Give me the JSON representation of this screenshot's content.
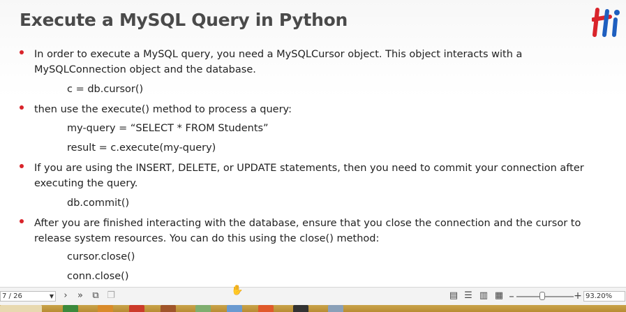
{
  "slide": {
    "title": "Execute a MySQL Query in Python",
    "accent_color": "#d9242b",
    "logo_icon": "hi-logo",
    "bullets": [
      {
        "text": "In order to execute a MySQL query, you need a MySQLCursor object. This object interacts with a MySQLConnection object and the database.",
        "code": [
          "c = db.cursor()"
        ]
      },
      {
        "text": "then use the execute() method to process a query:",
        "code": [
          "my-query = “SELECT * FROM Students”",
          "result = c.execute(my-query)"
        ]
      },
      {
        "text": "If you are using the INSERT, DELETE, or UPDATE statements, then you need to commit your connection after executing the query.",
        "code": [
          "db.commit()"
        ]
      },
      {
        "text": "After you are finished interacting with the database, ensure that you close the connection and the cursor to release system resources. You can do this using the close() method:",
        "code": [
          "cursor.close()",
          "conn.close()"
        ]
      }
    ]
  },
  "statusbar": {
    "page_indicator": "7 / 26",
    "zoom_level": "93.20%",
    "zoom_fraction": 0.45,
    "icons": [
      "next-page-icon",
      "last-page-icon",
      "page-view-icon",
      "copy-icon",
      "single-page-icon",
      "continuous-icon",
      "facing-icon",
      "thumbnails-icon",
      "zoom-out-icon",
      "zoom-in-icon"
    ],
    "zoom_out_label": "–",
    "zoom_in_label": "+"
  }
}
